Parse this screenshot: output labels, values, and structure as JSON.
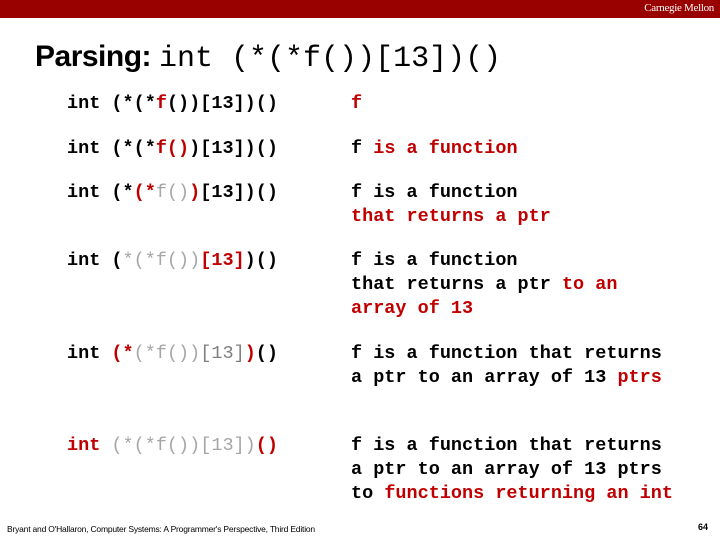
{
  "header": {
    "brand": "Carnegie Mellon",
    "bar_color": "#990000"
  },
  "title": {
    "label": "Parsing:",
    "code": "int (*(*f())[13])()"
  },
  "colors": {
    "highlight": "#c00000",
    "parsed": "#a6a6a6",
    "normal": "#000000"
  },
  "rows": [
    {
      "code": [
        {
          "t": "int (*(*",
          "s": "k"
        },
        {
          "t": "f",
          "s": "r"
        },
        {
          "t": "())[13])()",
          "s": "k"
        }
      ],
      "desc": [
        [
          {
            "t": "f",
            "s": "r"
          }
        ]
      ]
    },
    {
      "code": [
        {
          "t": "int (*(*",
          "s": "k"
        },
        {
          "t": "f()",
          "s": "r"
        },
        {
          "t": ")[13])()",
          "s": "k"
        }
      ],
      "desc": [
        [
          {
            "t": "f ",
            "s": "k"
          },
          {
            "t": "is a function",
            "s": "r"
          }
        ]
      ]
    },
    {
      "code": [
        {
          "t": "int (*",
          "s": "k"
        },
        {
          "t": "(*",
          "s": "r"
        },
        {
          "t": "f()",
          "s": "g"
        },
        {
          "t": ")",
          "s": "r"
        },
        {
          "t": "[13])()",
          "s": "k"
        }
      ],
      "desc": [
        [
          {
            "t": "f is a function",
            "s": "k"
          }
        ],
        [
          {
            "t": "that returns a ptr",
            "s": "r"
          }
        ]
      ]
    },
    {
      "code": [
        {
          "t": "int (",
          "s": "k"
        },
        {
          "t": "*(*f())",
          "s": "g"
        },
        {
          "t": "[13]",
          "s": "r"
        },
        {
          "t": ")()",
          "s": "k"
        }
      ],
      "desc": [
        [
          {
            "t": "f is a function",
            "s": "k"
          }
        ],
        [
          {
            "t": "that returns a ptr ",
            "s": "k"
          },
          {
            "t": "to an",
            "s": "r"
          }
        ],
        [
          {
            "t": "array of 13",
            "s": "r"
          }
        ]
      ]
    },
    {
      "code": [
        {
          "t": "int ",
          "s": "k"
        },
        {
          "t": "(*",
          "s": "r"
        },
        {
          "t": "(*f())",
          "s": "g"
        },
        {
          "t": "[13]",
          "s": "dg"
        },
        {
          "t": ")",
          "s": "r"
        },
        {
          "t": "()",
          "s": "k"
        }
      ],
      "desc": [
        [
          {
            "t": "f is a function that returns",
            "s": "k"
          }
        ],
        [
          {
            "t": "a ptr to an array of 13 ",
            "s": "k"
          },
          {
            "t": "ptrs",
            "s": "r"
          }
        ]
      ]
    },
    {
      "code": [
        {
          "t": "int",
          "s": "r"
        },
        {
          "t": " ",
          "s": "k"
        },
        {
          "t": "(*(*f())[13])",
          "s": "g"
        },
        {
          "t": "()",
          "s": "r"
        }
      ],
      "desc": [
        [
          {
            "t": "f is a function that returns",
            "s": "k"
          }
        ],
        [
          {
            "t": "a ptr to an array of 13 ptrs",
            "s": "k"
          }
        ],
        [
          {
            "t": "to ",
            "s": "k"
          },
          {
            "t": "functions returning an int",
            "s": "r"
          }
        ]
      ]
    }
  ],
  "footer": {
    "citation": "Bryant and O'Hallaron, Computer Systems: A Programmer's Perspective, Third Edition",
    "page": "64"
  }
}
